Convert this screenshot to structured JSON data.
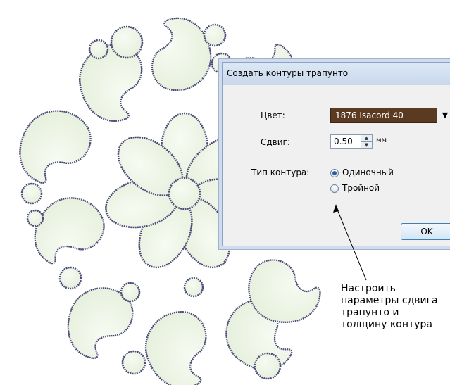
{
  "dialog": {
    "title": "Создать контуры трапунто",
    "color_label": "Цвет:",
    "color_value": "1876 Isacord 40",
    "color_swatch": "#5b3a22",
    "offset_label": "Сдвиг:",
    "offset_value": "0.50",
    "offset_unit": "мм",
    "outline_type_label": "Тип контура:",
    "outline_options": [
      "Одиночный",
      "Тройной"
    ],
    "outline_selected": "Одиночный",
    "ok_label": "OK"
  },
  "annotation": {
    "text": "Настроить параметры сдвига трапунто и толщину контура"
  },
  "icons": [
    "dropdown-arrow-icon",
    "spin-up-icon",
    "spin-down-icon",
    "pointer-arrow-icon"
  ]
}
